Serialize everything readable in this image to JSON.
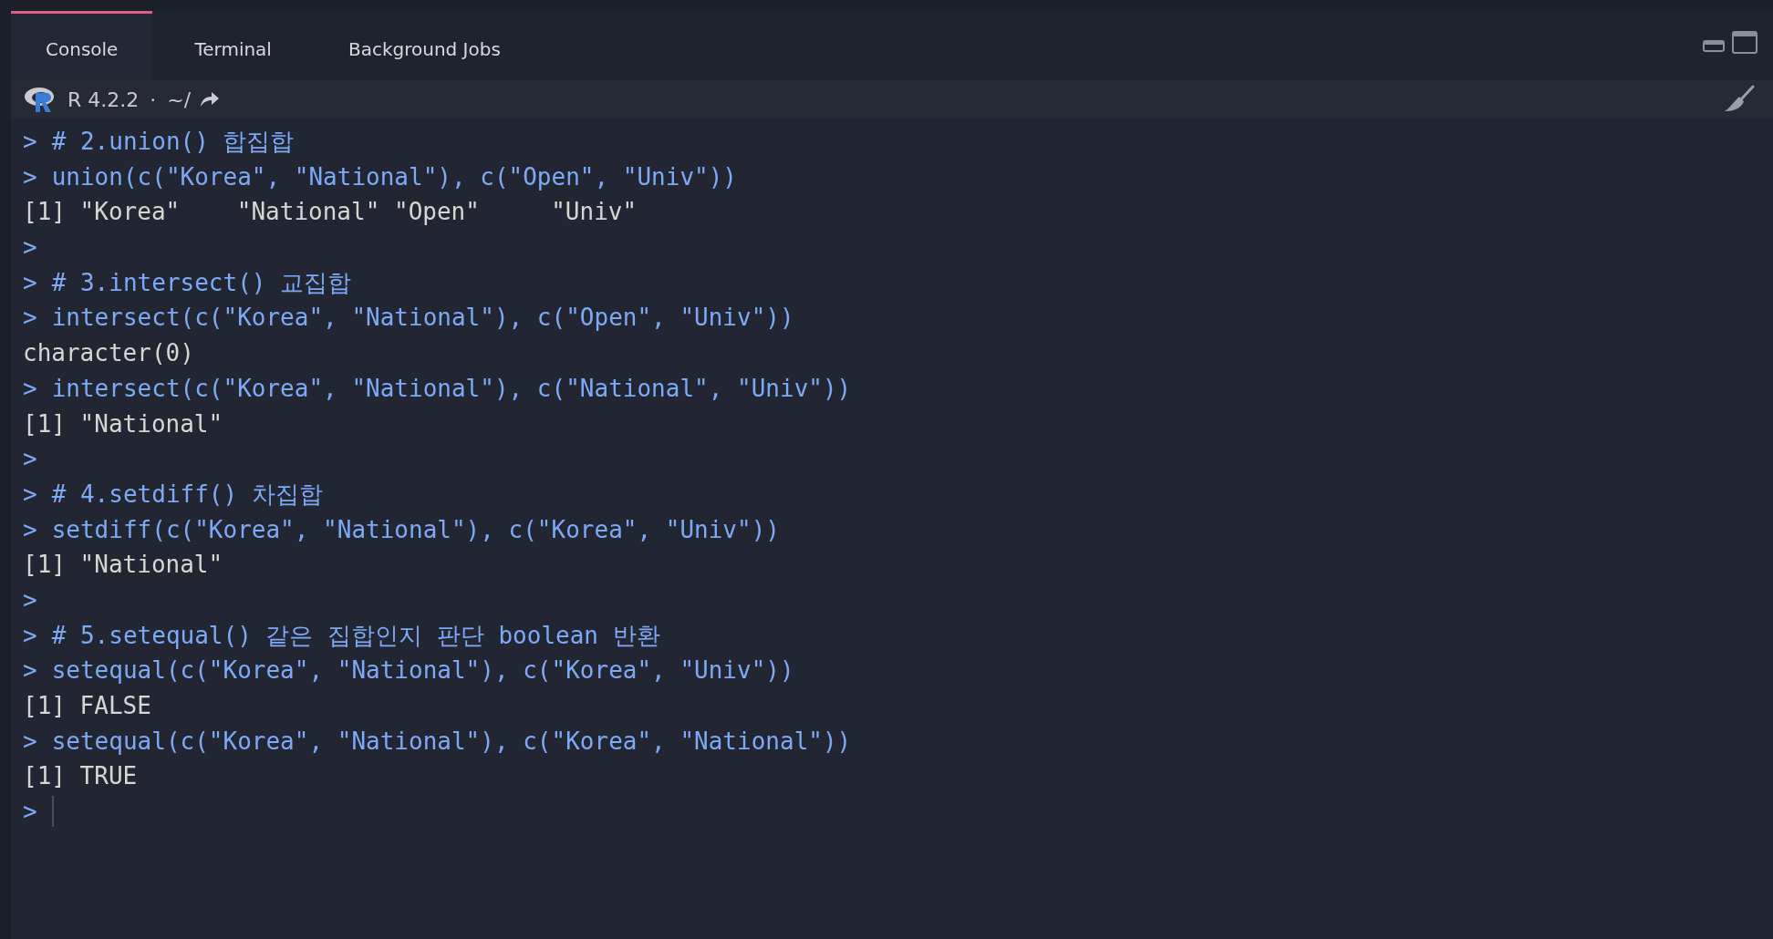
{
  "tabs": [
    {
      "label": "Console",
      "selected": true
    },
    {
      "label": "Terminal",
      "selected": false
    },
    {
      "label": "Background Jobs",
      "selected": false
    }
  ],
  "toolbar": {
    "r_version": "R 4.2.2",
    "separator": "·",
    "directory": "~/"
  },
  "console": {
    "lines": [
      {
        "kind": "input",
        "prompt": ">",
        "text": "# 2.union() 합집합"
      },
      {
        "kind": "input",
        "prompt": ">",
        "text": "union(c(\"Korea\", \"National\"), c(\"Open\", \"Univ\"))"
      },
      {
        "kind": "output",
        "text": "[1] \"Korea\"    \"National\" \"Open\"     \"Univ\""
      },
      {
        "kind": "input",
        "prompt": ">"
      },
      {
        "kind": "input",
        "prompt": ">",
        "text": "# 3.intersect() 교집합"
      },
      {
        "kind": "input",
        "prompt": ">",
        "text": "intersect(c(\"Korea\", \"National\"), c(\"Open\", \"Univ\"))"
      },
      {
        "kind": "output",
        "text": "character(0)"
      },
      {
        "kind": "input",
        "prompt": ">",
        "text": "intersect(c(\"Korea\", \"National\"), c(\"National\", \"Univ\"))"
      },
      {
        "kind": "output",
        "text": "[1] \"National\""
      },
      {
        "kind": "input",
        "prompt": ">"
      },
      {
        "kind": "input",
        "prompt": ">",
        "text": "# 4.setdiff() 차집합"
      },
      {
        "kind": "input",
        "prompt": ">",
        "text": "setdiff(c(\"Korea\", \"National\"), c(\"Korea\", \"Univ\"))"
      },
      {
        "kind": "output",
        "text": "[1] \"National\""
      },
      {
        "kind": "input",
        "prompt": ">"
      },
      {
        "kind": "input",
        "prompt": ">",
        "text": "# 5.setequal() 같은 집합인지 판단 boolean 반환"
      },
      {
        "kind": "input",
        "prompt": ">",
        "text": "setequal(c(\"Korea\", \"National\"), c(\"Korea\", \"Univ\"))"
      },
      {
        "kind": "output",
        "text": "[1] FALSE"
      },
      {
        "kind": "input",
        "prompt": ">",
        "text": "setequal(c(\"Korea\", \"National\"), c(\"Korea\", \"National\"))"
      },
      {
        "kind": "output",
        "text": "[1] TRUE"
      }
    ],
    "current_prompt": {
      "prompt": ">"
    }
  }
}
